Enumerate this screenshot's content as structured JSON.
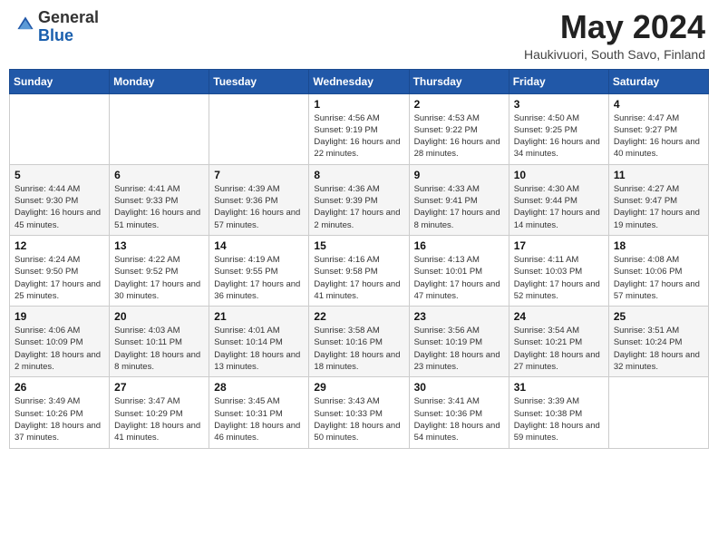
{
  "header": {
    "logo_general": "General",
    "logo_blue": "Blue",
    "month_year": "May 2024",
    "location": "Haukivuori, South Savo, Finland"
  },
  "weekdays": [
    "Sunday",
    "Monday",
    "Tuesday",
    "Wednesday",
    "Thursday",
    "Friday",
    "Saturday"
  ],
  "weeks": [
    [
      {
        "day": "",
        "info": ""
      },
      {
        "day": "",
        "info": ""
      },
      {
        "day": "",
        "info": ""
      },
      {
        "day": "1",
        "info": "Sunrise: 4:56 AM\nSunset: 9:19 PM\nDaylight: 16 hours\nand 22 minutes."
      },
      {
        "day": "2",
        "info": "Sunrise: 4:53 AM\nSunset: 9:22 PM\nDaylight: 16 hours\nand 28 minutes."
      },
      {
        "day": "3",
        "info": "Sunrise: 4:50 AM\nSunset: 9:25 PM\nDaylight: 16 hours\nand 34 minutes."
      },
      {
        "day": "4",
        "info": "Sunrise: 4:47 AM\nSunset: 9:27 PM\nDaylight: 16 hours\nand 40 minutes."
      }
    ],
    [
      {
        "day": "5",
        "info": "Sunrise: 4:44 AM\nSunset: 9:30 PM\nDaylight: 16 hours\nand 45 minutes."
      },
      {
        "day": "6",
        "info": "Sunrise: 4:41 AM\nSunset: 9:33 PM\nDaylight: 16 hours\nand 51 minutes."
      },
      {
        "day": "7",
        "info": "Sunrise: 4:39 AM\nSunset: 9:36 PM\nDaylight: 16 hours\nand 57 minutes."
      },
      {
        "day": "8",
        "info": "Sunrise: 4:36 AM\nSunset: 9:39 PM\nDaylight: 17 hours\nand 2 minutes."
      },
      {
        "day": "9",
        "info": "Sunrise: 4:33 AM\nSunset: 9:41 PM\nDaylight: 17 hours\nand 8 minutes."
      },
      {
        "day": "10",
        "info": "Sunrise: 4:30 AM\nSunset: 9:44 PM\nDaylight: 17 hours\nand 14 minutes."
      },
      {
        "day": "11",
        "info": "Sunrise: 4:27 AM\nSunset: 9:47 PM\nDaylight: 17 hours\nand 19 minutes."
      }
    ],
    [
      {
        "day": "12",
        "info": "Sunrise: 4:24 AM\nSunset: 9:50 PM\nDaylight: 17 hours\nand 25 minutes."
      },
      {
        "day": "13",
        "info": "Sunrise: 4:22 AM\nSunset: 9:52 PM\nDaylight: 17 hours\nand 30 minutes."
      },
      {
        "day": "14",
        "info": "Sunrise: 4:19 AM\nSunset: 9:55 PM\nDaylight: 17 hours\nand 36 minutes."
      },
      {
        "day": "15",
        "info": "Sunrise: 4:16 AM\nSunset: 9:58 PM\nDaylight: 17 hours\nand 41 minutes."
      },
      {
        "day": "16",
        "info": "Sunrise: 4:13 AM\nSunset: 10:01 PM\nDaylight: 17 hours\nand 47 minutes."
      },
      {
        "day": "17",
        "info": "Sunrise: 4:11 AM\nSunset: 10:03 PM\nDaylight: 17 hours\nand 52 minutes."
      },
      {
        "day": "18",
        "info": "Sunrise: 4:08 AM\nSunset: 10:06 PM\nDaylight: 17 hours\nand 57 minutes."
      }
    ],
    [
      {
        "day": "19",
        "info": "Sunrise: 4:06 AM\nSunset: 10:09 PM\nDaylight: 18 hours\nand 2 minutes."
      },
      {
        "day": "20",
        "info": "Sunrise: 4:03 AM\nSunset: 10:11 PM\nDaylight: 18 hours\nand 8 minutes."
      },
      {
        "day": "21",
        "info": "Sunrise: 4:01 AM\nSunset: 10:14 PM\nDaylight: 18 hours\nand 13 minutes."
      },
      {
        "day": "22",
        "info": "Sunrise: 3:58 AM\nSunset: 10:16 PM\nDaylight: 18 hours\nand 18 minutes."
      },
      {
        "day": "23",
        "info": "Sunrise: 3:56 AM\nSunset: 10:19 PM\nDaylight: 18 hours\nand 23 minutes."
      },
      {
        "day": "24",
        "info": "Sunrise: 3:54 AM\nSunset: 10:21 PM\nDaylight: 18 hours\nand 27 minutes."
      },
      {
        "day": "25",
        "info": "Sunrise: 3:51 AM\nSunset: 10:24 PM\nDaylight: 18 hours\nand 32 minutes."
      }
    ],
    [
      {
        "day": "26",
        "info": "Sunrise: 3:49 AM\nSunset: 10:26 PM\nDaylight: 18 hours\nand 37 minutes."
      },
      {
        "day": "27",
        "info": "Sunrise: 3:47 AM\nSunset: 10:29 PM\nDaylight: 18 hours\nand 41 minutes."
      },
      {
        "day": "28",
        "info": "Sunrise: 3:45 AM\nSunset: 10:31 PM\nDaylight: 18 hours\nand 46 minutes."
      },
      {
        "day": "29",
        "info": "Sunrise: 3:43 AM\nSunset: 10:33 PM\nDaylight: 18 hours\nand 50 minutes."
      },
      {
        "day": "30",
        "info": "Sunrise: 3:41 AM\nSunset: 10:36 PM\nDaylight: 18 hours\nand 54 minutes."
      },
      {
        "day": "31",
        "info": "Sunrise: 3:39 AM\nSunset: 10:38 PM\nDaylight: 18 hours\nand 59 minutes."
      },
      {
        "day": "",
        "info": ""
      }
    ]
  ]
}
